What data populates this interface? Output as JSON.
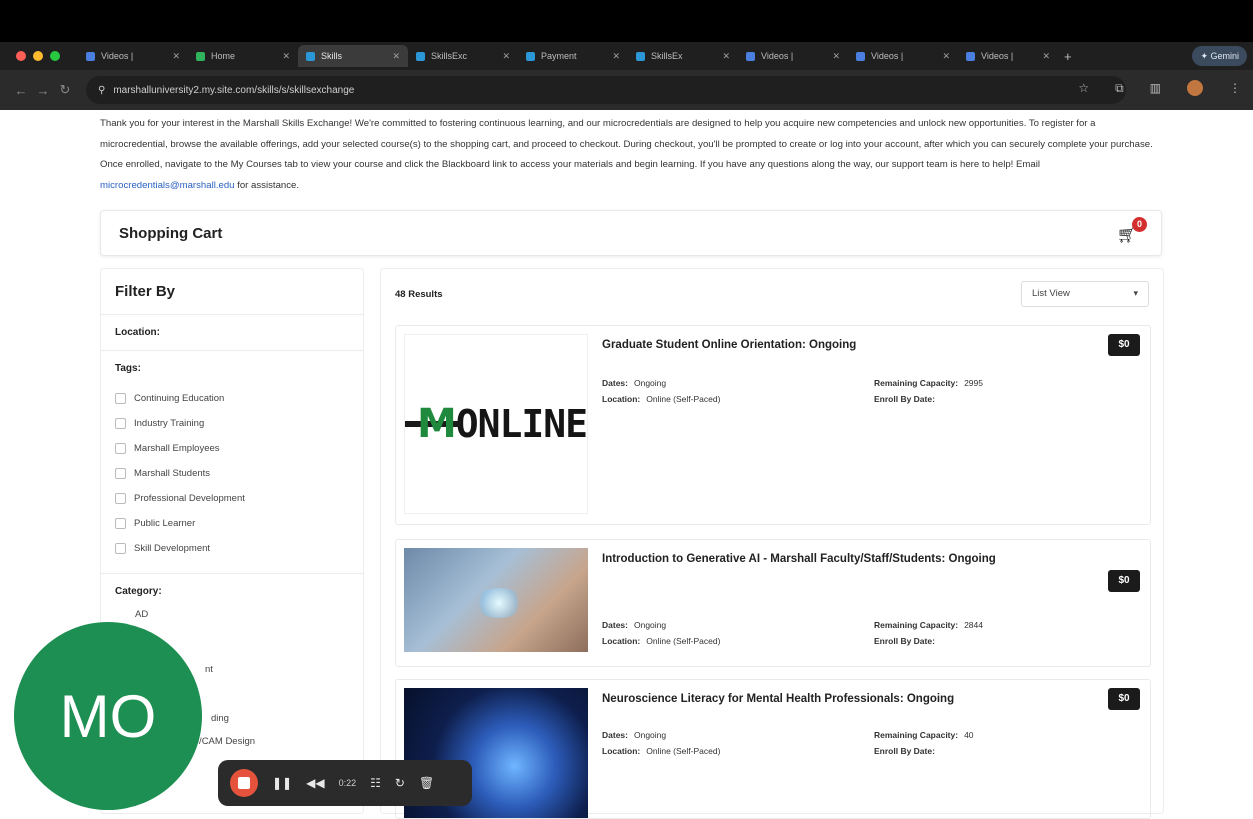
{
  "browser": {
    "tabs": [
      {
        "label": "Videos |",
        "color": "#4a7fe0"
      },
      {
        "label": "Home",
        "color": "#2fb35c"
      },
      {
        "label": "Skills",
        "color": "#2c97d6"
      },
      {
        "label": "SkillsExc",
        "color": "#2c97d6"
      },
      {
        "label": "Payment",
        "color": "#2c97d6"
      },
      {
        "label": "SkillsEx",
        "color": "#2c97d6"
      },
      {
        "label": "Videos |",
        "color": "#4a7fe0"
      },
      {
        "label": "Videos |",
        "color": "#4a7fe0"
      },
      {
        "label": "Videos |",
        "color": "#4a7fe0"
      }
    ],
    "gemini_label": "Gemini",
    "url": "marshalluniversity2.my.site.com/skills/s/skillsexchange"
  },
  "intro": {
    "text": "Thank you for your interest in the Marshall Skills Exchange! We're committed to fostering continuous learning, and our microcredentials are designed to help you acquire new competencies and unlock new opportunities. To register for a microcredential, browse the available offerings, add your selected course(s) to the shopping cart, and proceed to checkout. During checkout, you'll be prompted to create or log into your account, after which you can securely complete your purchase. Once enrolled, navigate to the My Courses tab to view your course and click the Blackboard link to access your materials and begin learning. If you have any questions along the way, our support team is here to help! Email ",
    "email": "microcredentials@marshall.edu",
    "suffix": " for assistance."
  },
  "cart": {
    "title": "Shopping Cart",
    "count": "0"
  },
  "filter": {
    "title": "Filter By",
    "location_label": "Location:",
    "tags_label": "Tags:",
    "tags": [
      "Continuing Education",
      "Industry Training",
      "Marshall Employees",
      "Marshall Students",
      "Professional Development",
      "Public Learner",
      "Skill Development"
    ],
    "category_label": "Category:",
    "categories": [
      "AD",
      "nt",
      "ding",
      "CAD/CAM Design"
    ]
  },
  "results": {
    "count": "48 Results",
    "view": "List View",
    "courses": [
      {
        "title": "Graduate Student Online Orientation: Ongoing",
        "price": "$0",
        "dates_label": "Dates:",
        "dates": "Ongoing",
        "location_label": "Location:",
        "location": "Online (Self-Paced)",
        "capacity_label": "Remaining Capacity:",
        "capacity": "2995",
        "enroll_label": "Enroll By Date:",
        "enroll": ""
      },
      {
        "title": "Introduction to Generative AI - Marshall Faculty/Staff/Students: Ongoing",
        "price": "$0",
        "dates_label": "Dates:",
        "dates": "Ongoing",
        "location_label": "Location:",
        "location": "Online (Self-Paced)",
        "capacity_label": "Remaining Capacity:",
        "capacity": "2844",
        "enroll_label": "Enroll By Date:",
        "enroll": ""
      },
      {
        "title": "Neuroscience Literacy for Mental Health Professionals: Ongoing",
        "price": "$0",
        "dates_label": "Dates:",
        "dates": "Ongoing",
        "location_label": "Location:",
        "location": "Online (Self-Paced)",
        "capacity_label": "Remaining Capacity:",
        "capacity": "40",
        "enroll_label": "Enroll By Date:",
        "enroll": ""
      }
    ],
    "logo_text": "ONLINE"
  },
  "overlay": {
    "initials": "MO",
    "time": "0:22"
  }
}
